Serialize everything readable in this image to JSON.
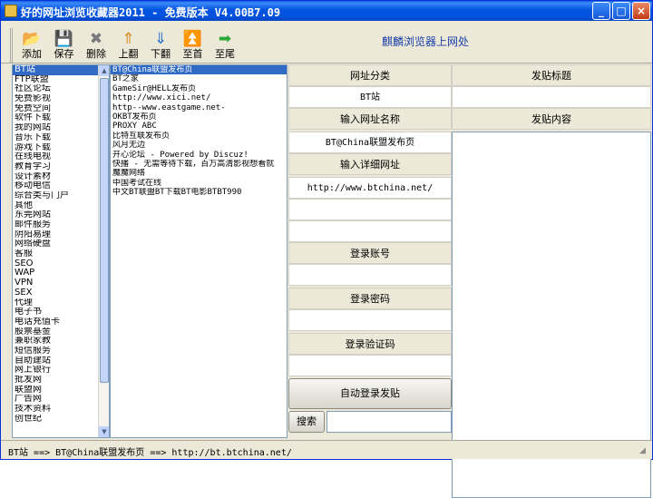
{
  "window": {
    "title": "好的网址浏览收藏器2011 - 免费版本 V4.00B7.09",
    "btn_minimize": "_",
    "btn_maximize": "□",
    "btn_close": "×"
  },
  "toolbar": {
    "items": [
      {
        "label": "添加",
        "icon": "folder-add-icon",
        "glyph": "📂",
        "color": "#d9a52a"
      },
      {
        "label": "保存",
        "icon": "save-icon",
        "glyph": "💾",
        "color": "#2a58c8"
      },
      {
        "label": "删除",
        "icon": "delete-icon",
        "glyph": "✖",
        "color": "#7a7a7a"
      },
      {
        "label": "上翻",
        "icon": "arrow-up-icon",
        "glyph": "⇑",
        "color": "#d48a1c"
      },
      {
        "label": "下翻",
        "icon": "arrow-down-icon",
        "glyph": "⇓",
        "color": "#2a70c8"
      },
      {
        "label": "至首",
        "icon": "to-first-icon",
        "glyph": "⏫",
        "color": "#c8283a"
      },
      {
        "label": "至尾",
        "icon": "to-last-icon",
        "glyph": "➡",
        "color": "#2aa838"
      }
    ],
    "open_in_browser": "麒麟浏览器上网处"
  },
  "categories": {
    "items": [
      "BT站",
      "FTP联盟",
      "社区论坛",
      "免费影视",
      "免费空间",
      "软件下载",
      "我的网站",
      "音乐下载",
      "游戏下载",
      "在线电视",
      "教育学习",
      "设计素材",
      "移动电信",
      "综合类与门户",
      "其他",
      "东莞网站",
      "邮件服务",
      "阴阳易理",
      "网络硬盘",
      "客服",
      "SEO",
      "WAP",
      "VPN",
      "SEX",
      "代理",
      "电子书",
      "电话充值卡",
      "股票基金",
      "兼职家教",
      "短信服务",
      "自助建站",
      "网上银行",
      "批发网",
      "联盟网",
      "广告网",
      "技术资料",
      "创世纪"
    ],
    "selected": 0
  },
  "sites": {
    "items": [
      "BT@China联盟发布页",
      "BT之家",
      "GameSir@HELL发布页",
      "http://www.xici.net/",
      "http--www.eastgame.net-",
      "OKBT发布页",
      "PROXY ABC",
      "比特互联发布页",
      "风月无边",
      "开心论坛 - Powered by Discuz!",
      "快播 - 无需等待下载，百万高清影视想看就",
      "魔魔网络",
      "中国考试在线",
      "中文BT联盟BT下载BT电影BTBT990"
    ],
    "selected": 0
  },
  "form": {
    "category_label": "网址分类",
    "category_value": "BT站",
    "name_label": "输入网址名称",
    "name_value": "BT@China联盟发布页",
    "detail_label": "输入详细网址",
    "detail_value": "http://www.btchina.net/",
    "account_label": "登录账号",
    "account_value": "",
    "password_label": "登录密码",
    "password_value": "",
    "captcha_label": "登录验证码",
    "captcha_value": "",
    "auto_login_button": "自动登录发贴",
    "search_button": "搜索",
    "search_value": ""
  },
  "post": {
    "title_label": "发贴标题",
    "title_value": "",
    "content_label": "发贴内容",
    "content_value": ""
  },
  "status": {
    "text": "BT站 ==> BT@China联盟发布页 ==> http://bt.btchina.net/"
  }
}
